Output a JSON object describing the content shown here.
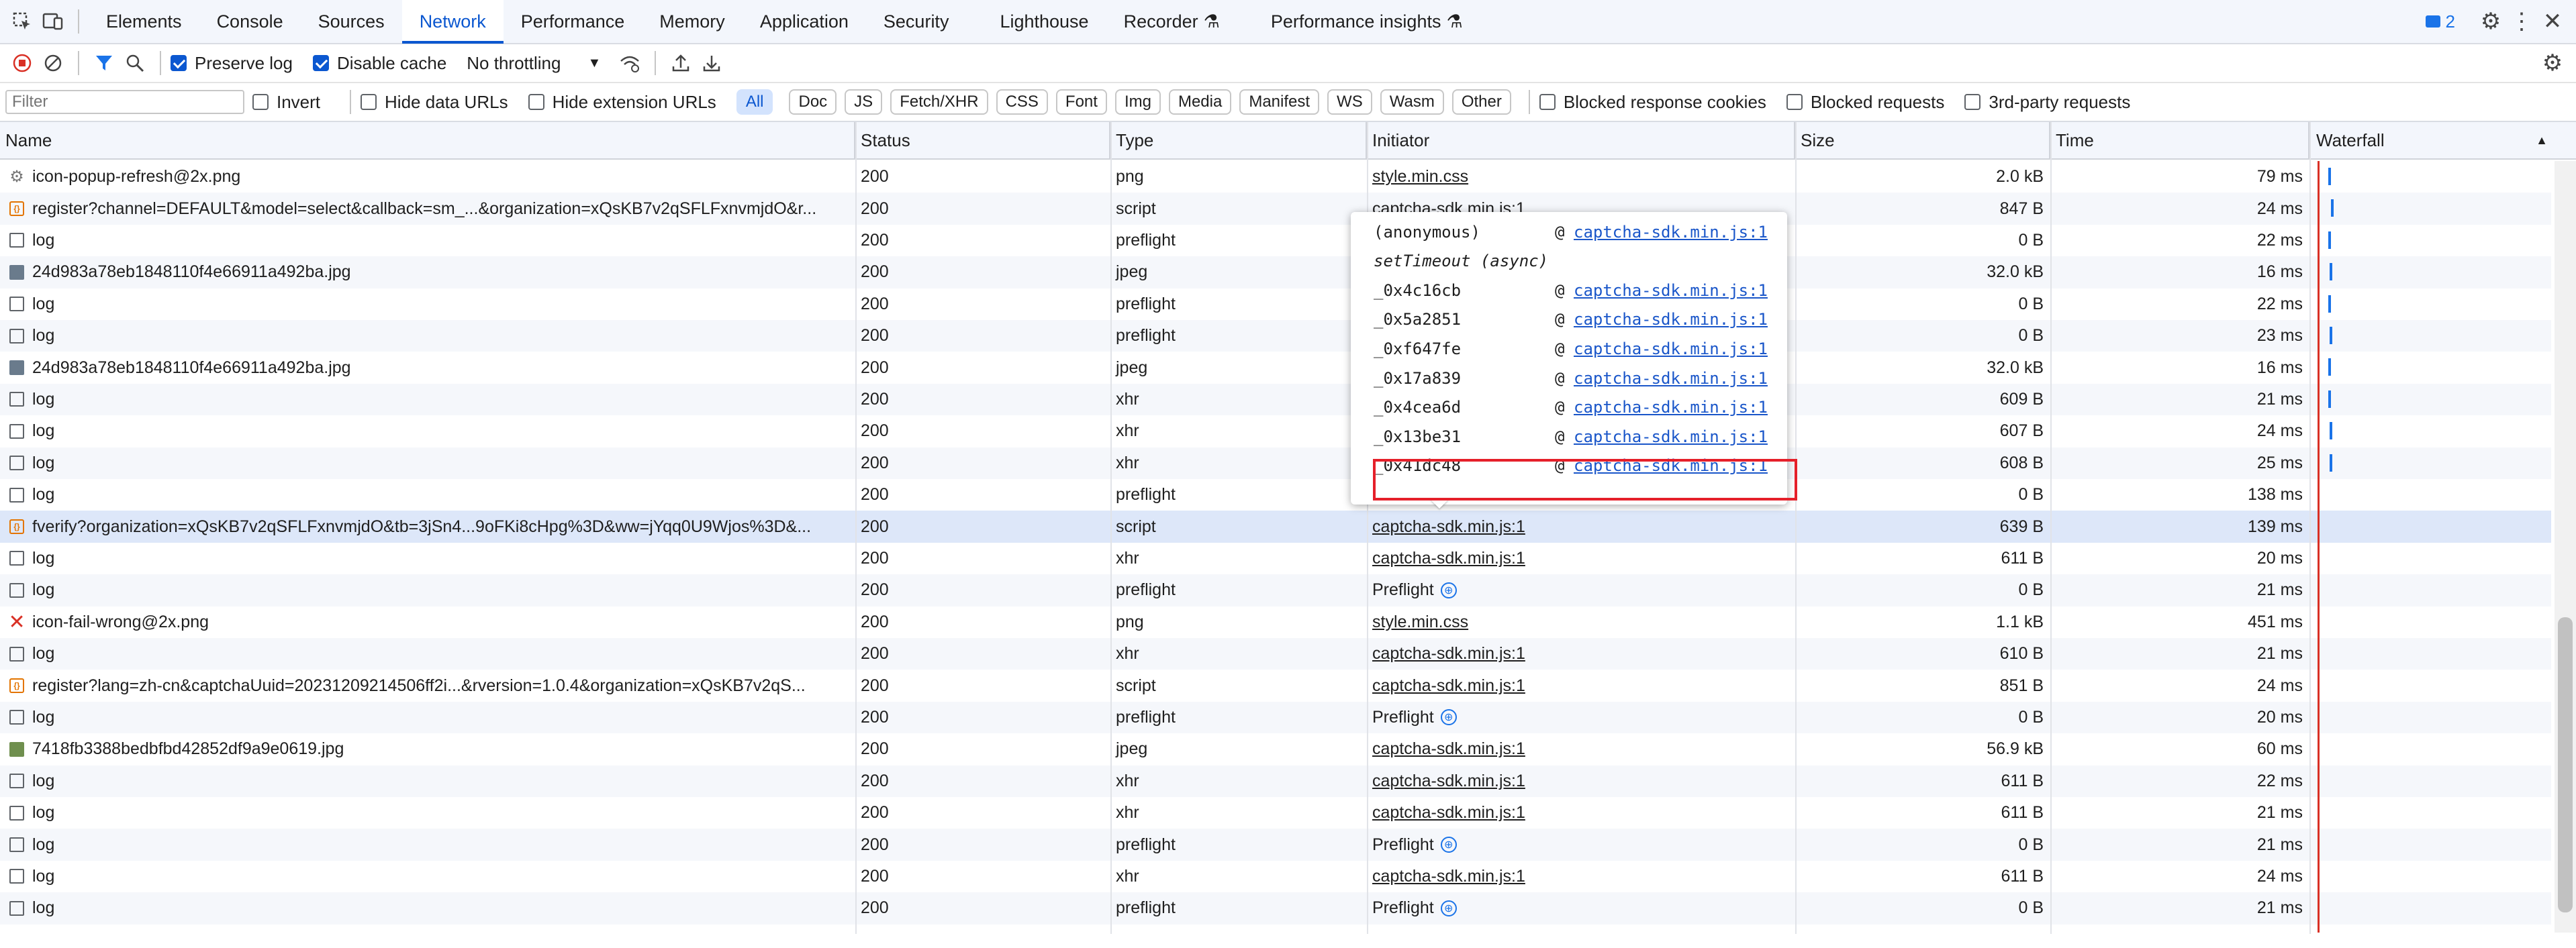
{
  "tabs": [
    "Elements",
    "Console",
    "Sources",
    "Network",
    "Performance",
    "Memory",
    "Application",
    "Security",
    "Lighthouse",
    "Recorder",
    "Performance insights"
  ],
  "active_tab": "Network",
  "issues_count": "2",
  "toolbar": {
    "preserve_log": "Preserve log",
    "disable_cache": "Disable cache",
    "throttling": "No throttling"
  },
  "filterbar": {
    "placeholder": "Filter",
    "invert": "Invert",
    "hide_data_urls": "Hide data URLs",
    "hide_extension_urls": "Hide extension URLs",
    "chips": [
      "All",
      "Doc",
      "JS",
      "Fetch/XHR",
      "CSS",
      "Font",
      "Img",
      "Media",
      "Manifest",
      "WS",
      "Wasm",
      "Other"
    ],
    "blocked_cookies": "Blocked response cookies",
    "blocked_requests": "Blocked requests",
    "third_party": "3rd-party requests"
  },
  "columns": {
    "name": "Name",
    "status": "Status",
    "type": "Type",
    "initiator": "Initiator",
    "size": "Size",
    "time": "Time",
    "waterfall": "Waterfall"
  },
  "rows": [
    {
      "icon": "gear",
      "name": "icon-popup-refresh@2x.png",
      "status": "200",
      "type": "png",
      "initiator": "style.min.css",
      "size": "2.0 kB",
      "time": "79 ms"
    },
    {
      "icon": "script",
      "name": "register?channel=DEFAULT&model=select&callback=sm_...&organization=xQsKB7v2qSFLFxnvmjdO&r...",
      "status": "200",
      "type": "script",
      "initiator": "captcha-sdk.min.js:1",
      "size": "847 B",
      "time": "24 ms"
    },
    {
      "icon": "doc",
      "name": "log",
      "status": "200",
      "type": "preflight",
      "initiator": "",
      "size": "0 B",
      "time": "22 ms"
    },
    {
      "icon": "img",
      "name": "24d983a78eb1848110f4e66911a492ba.jpg",
      "status": "200",
      "type": "jpeg",
      "initiator": "",
      "size": "32.0 kB",
      "time": "16 ms"
    },
    {
      "icon": "doc",
      "name": "log",
      "status": "200",
      "type": "preflight",
      "initiator": "",
      "size": "0 B",
      "time": "22 ms"
    },
    {
      "icon": "doc",
      "name": "log",
      "status": "200",
      "type": "preflight",
      "initiator": "",
      "size": "0 B",
      "time": "23 ms"
    },
    {
      "icon": "img",
      "name": "24d983a78eb1848110f4e66911a492ba.jpg",
      "status": "200",
      "type": "jpeg",
      "initiator": "",
      "size": "32.0 kB",
      "time": "16 ms"
    },
    {
      "icon": "doc",
      "name": "log",
      "status": "200",
      "type": "xhr",
      "initiator": "",
      "size": "609 B",
      "time": "21 ms"
    },
    {
      "icon": "doc",
      "name": "log",
      "status": "200",
      "type": "xhr",
      "initiator": "",
      "size": "607 B",
      "time": "24 ms"
    },
    {
      "icon": "doc",
      "name": "log",
      "status": "200",
      "type": "xhr",
      "initiator": "",
      "size": "608 B",
      "time": "25 ms"
    },
    {
      "icon": "doc",
      "name": "log",
      "status": "200",
      "type": "preflight",
      "initiator": "",
      "size": "0 B",
      "time": "138 ms"
    },
    {
      "icon": "script",
      "name": "fverify?organization=xQsKB7v2qSFLFxnvmjdO&tb=3jSn4...9oFKi8cHpg%3D&ww=jYqq0U9Wjos%3D&...",
      "status": "200",
      "type": "script",
      "initiator": "captcha-sdk.min.js:1",
      "size": "639 B",
      "time": "139 ms",
      "selected": true
    },
    {
      "icon": "doc",
      "name": "log",
      "status": "200",
      "type": "xhr",
      "initiator": "captcha-sdk.min.js:1",
      "size": "611 B",
      "time": "20 ms"
    },
    {
      "icon": "doc",
      "name": "log",
      "status": "200",
      "type": "preflight",
      "initiator": "Preflight",
      "size": "0 B",
      "time": "21 ms"
    },
    {
      "icon": "fail",
      "name": "icon-fail-wrong@2x.png",
      "status": "200",
      "type": "png",
      "initiator": "style.min.css",
      "size": "1.1 kB",
      "time": "451 ms"
    },
    {
      "icon": "doc",
      "name": "log",
      "status": "200",
      "type": "xhr",
      "initiator": "captcha-sdk.min.js:1",
      "size": "610 B",
      "time": "21 ms"
    },
    {
      "icon": "script",
      "name": "register?lang=zh-cn&captchaUuid=20231209214506ff2i...&rversion=1.0.4&organization=xQsKB7v2qS...",
      "status": "200",
      "type": "script",
      "initiator": "captcha-sdk.min.js:1",
      "size": "851 B",
      "time": "24 ms"
    },
    {
      "icon": "doc",
      "name": "log",
      "status": "200",
      "type": "preflight",
      "initiator": "Preflight",
      "size": "0 B",
      "time": "20 ms"
    },
    {
      "icon": "imgg",
      "name": "7418fb3388bedbfbd42852df9a9e0619.jpg",
      "status": "200",
      "type": "jpeg",
      "initiator": "captcha-sdk.min.js:1",
      "size": "56.9 kB",
      "time": "60 ms"
    },
    {
      "icon": "doc",
      "name": "log",
      "status": "200",
      "type": "xhr",
      "initiator": "captcha-sdk.min.js:1",
      "size": "611 B",
      "time": "22 ms"
    },
    {
      "icon": "doc",
      "name": "log",
      "status": "200",
      "type": "xhr",
      "initiator": "captcha-sdk.min.js:1",
      "size": "611 B",
      "time": "21 ms"
    },
    {
      "icon": "doc",
      "name": "log",
      "status": "200",
      "type": "preflight",
      "initiator": "Preflight",
      "size": "0 B",
      "time": "21 ms"
    },
    {
      "icon": "doc",
      "name": "log",
      "status": "200",
      "type": "xhr",
      "initiator": "captcha-sdk.min.js:1",
      "size": "611 B",
      "time": "24 ms"
    },
    {
      "icon": "doc",
      "name": "log",
      "status": "200",
      "type": "preflight",
      "initiator": "Preflight",
      "size": "0 B",
      "time": "21 ms"
    }
  ],
  "popup": {
    "at": "@",
    "stack": [
      {
        "fn": "(anonymous)",
        "link": "captcha-sdk.min.js:1"
      },
      {
        "fn": "setTimeout (async)",
        "link": ""
      },
      {
        "fn": "_0x4c16cb",
        "link": "captcha-sdk.min.js:1"
      },
      {
        "fn": "_0x5a2851",
        "link": "captcha-sdk.min.js:1"
      },
      {
        "fn": "_0xf647fe",
        "link": "captcha-sdk.min.js:1"
      },
      {
        "fn": "_0x17a839",
        "link": "captcha-sdk.min.js:1"
      },
      {
        "fn": "_0x4cea6d",
        "link": "captcha-sdk.min.js:1"
      },
      {
        "fn": "_0x13be31",
        "link": "captcha-sdk.min.js:1"
      },
      {
        "fn": "_0x41dc48",
        "link": "captcha-sdk.min.js:1"
      }
    ]
  },
  "colors": {
    "accent": "#0b57d0",
    "highlight_box": "#e5202a",
    "selected_row": "#dde7f9"
  }
}
